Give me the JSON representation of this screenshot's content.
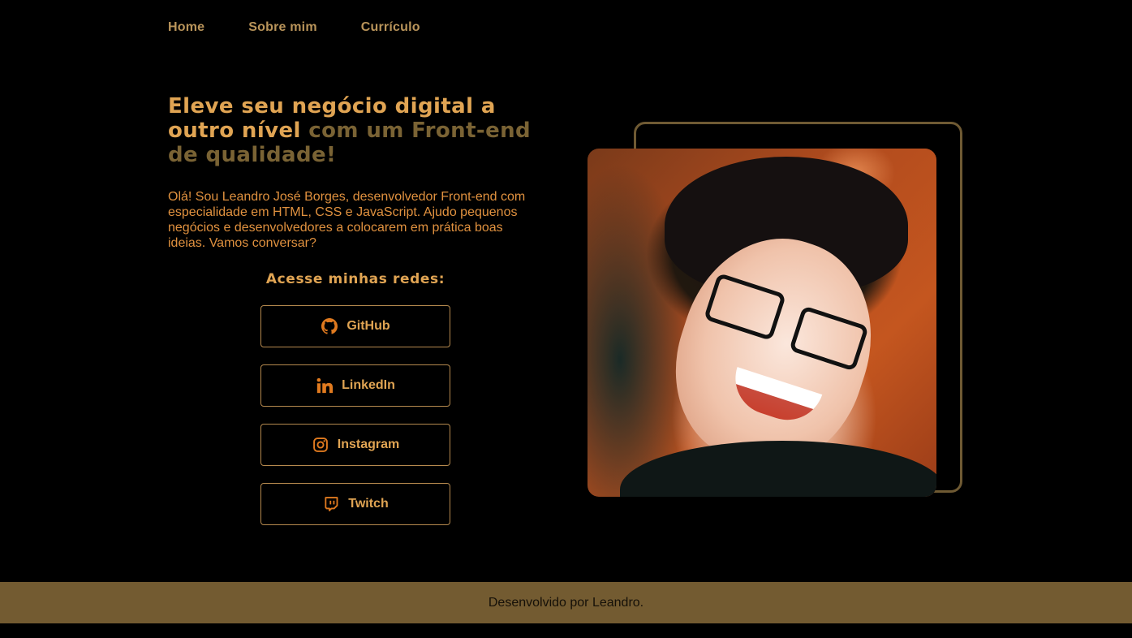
{
  "nav": {
    "items": [
      {
        "label": "Home"
      },
      {
        "label": "Sobre mim"
      },
      {
        "label": "Currículo"
      }
    ]
  },
  "hero": {
    "title_highlight": "Eleve seu negócio digital a outro nível",
    "title_rest": " com um Front-end de qualidade!",
    "intro": "Olá! Sou Leandro José Borges, desenvolvedor Front-end com especialidade em HTML, CSS e JavaScript. Ajudo pequenos negócios e desenvolvedores a colocarem em prática boas ideias. Vamos conversar?"
  },
  "socials": {
    "title": "Acesse minhas redes:",
    "links": [
      {
        "label": "GitHub",
        "icon": "github-icon"
      },
      {
        "label": "LinkedIn",
        "icon": "linkedin-icon"
      },
      {
        "label": "Instagram",
        "icon": "instagram-icon"
      },
      {
        "label": "Twitch",
        "icon": "twitch-icon"
      }
    ]
  },
  "footer": {
    "text": "Desenvolvido por Leandro."
  },
  "colors": {
    "accent": "#e0a453",
    "accent_dim": "#7a6334",
    "icon": "#e07a1f",
    "footer_bg": "#735b31",
    "background": "#000000"
  }
}
